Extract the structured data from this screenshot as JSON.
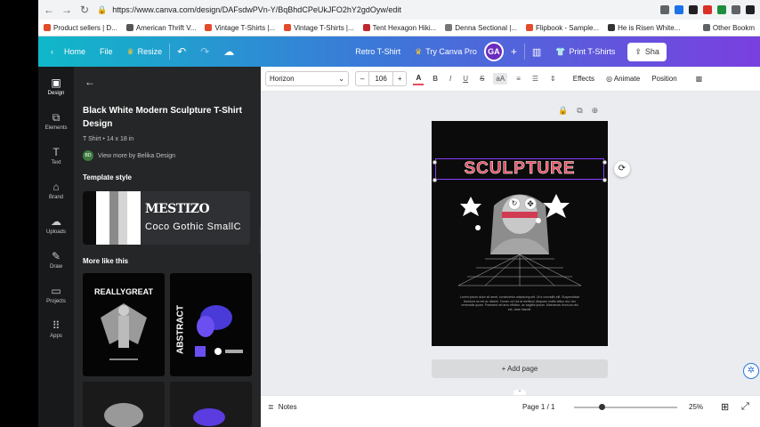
{
  "browser": {
    "url": "https://www.canva.com/design/DAFsdwPVn-Y/BqBhdCPeUkJFO2hY2gdOyw/edit",
    "bookmarks": [
      "Product sellers | D...",
      "American Thrift V...",
      "Vintage T-Shirts |...",
      "Vintage T-Shirts |...",
      "Tent Hexagon Hiki...",
      "Denna Sectional |...",
      "Flipbook - Sample...",
      "He is Risen White..."
    ],
    "other_bookmarks": "Other Bookm"
  },
  "header": {
    "home": "Home",
    "file": "File",
    "resize": "Resize",
    "design_title": "Retro T-Shirt",
    "try_pro": "Try Canva Pro",
    "avatar": "GA",
    "print": "Print T-Shirts",
    "share": "Sha"
  },
  "rail": [
    {
      "label": "Design",
      "icon": "design-icon"
    },
    {
      "label": "Elements",
      "icon": "elements-icon"
    },
    {
      "label": "Text",
      "icon": "text-icon"
    },
    {
      "label": "Brand",
      "icon": "brand-icon"
    },
    {
      "label": "Uploads",
      "icon": "uploads-icon"
    },
    {
      "label": "Draw",
      "icon": "draw-icon"
    },
    {
      "label": "Projects",
      "icon": "projects-icon"
    },
    {
      "label": "Apps",
      "icon": "apps-icon"
    }
  ],
  "panel": {
    "title": "Black White Modern Sculpture T-Shirt Design",
    "meta": "T Shirt • 14 x 18 in",
    "author_initials": "BD",
    "author": "View more by Belika Design",
    "template_style": "Template style",
    "font_primary": "MESTIZO",
    "font_secondary": "Coco Gothic SmallC",
    "more_like": "More like this",
    "thumb1_text": "REALLYGREAT",
    "thumb2_text": "ABSTRACT"
  },
  "toolbar": {
    "font": "Horizon",
    "size": "106",
    "effects": "Effects",
    "animate": "Animate",
    "position": "Position"
  },
  "design": {
    "headline": "SCULPTURE",
    "body": "Lorem ipsum dolor sit amet, consectetur adipiscing elit. Ut a convallis elit. Suspendisse tincidunt ac est ac dictum. Donec vel dui at eleifend. Aliquam mollis tellus dui, nec venenatis quam. Praesent vel arcu efficitur, ac sagittis ipsum. Maecenas rhoncus nisl est, vitae blandit."
  },
  "add_page": "+ Add page",
  "footer": {
    "notes": "Notes",
    "page": "Page 1 / 1",
    "zoom": "25%",
    "zoom_fraction": 0.25
  },
  "colors": {
    "headline": "#e84a5f",
    "selection": "#8b3dff",
    "panel_bg": "#252627"
  }
}
